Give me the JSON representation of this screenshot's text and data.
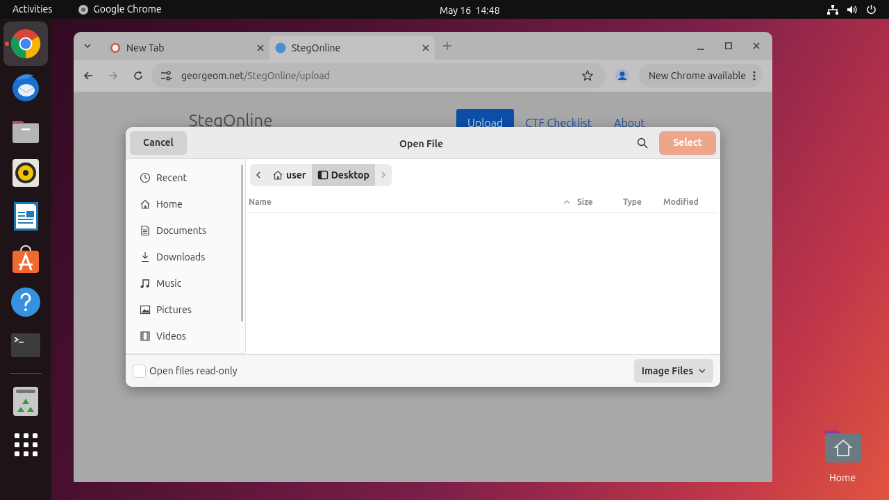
{
  "top_bar": {
    "activities": "Activities",
    "app_name": "Google Chrome",
    "clock": "May 16  14:48"
  },
  "dock": [
    {
      "kind": "chrome",
      "running": true
    },
    {
      "kind": "mail",
      "running": false
    },
    {
      "kind": "files",
      "running": false
    },
    {
      "kind": "speaker",
      "running": false
    },
    {
      "kind": "writer",
      "running": false
    },
    {
      "kind": "store",
      "running": false
    },
    {
      "kind": "help",
      "running": false
    },
    {
      "kind": "terminal",
      "running": false
    },
    {
      "kind": "trash",
      "running": false
    },
    {
      "kind": "apps",
      "running": false
    }
  ],
  "browser": {
    "tabs": [
      {
        "title": "New Tab",
        "selected": false
      },
      {
        "title": "StegOnline",
        "selected": true
      }
    ],
    "address": {
      "host": "georgeom.net",
      "path": "/StegOnline/upload"
    },
    "update_button": "New Chrome available",
    "page": {
      "site_title": "StegOnline",
      "nav": [
        {
          "label": "Upload",
          "selected": true
        },
        {
          "label": "CTF Checklist",
          "selected": false
        },
        {
          "label": "About",
          "selected": false
        }
      ]
    }
  },
  "dialog": {
    "title": "Open File",
    "cancel": "Cancel",
    "select": {
      "label": "Select",
      "disabled": true
    },
    "sidebar": [
      {
        "label": "Recent",
        "kind": "clock"
      },
      {
        "label": "Home",
        "kind": "home"
      },
      {
        "label": "Documents",
        "kind": "document"
      },
      {
        "label": "Downloads",
        "kind": "download"
      },
      {
        "label": "Music",
        "kind": "music"
      },
      {
        "label": "Pictures",
        "kind": "image"
      },
      {
        "label": "Videos",
        "kind": "film"
      }
    ],
    "path": [
      {
        "label": "user",
        "kind": "home",
        "selected": false
      },
      {
        "label": "Desktop",
        "kind": "desktop",
        "selected": true
      }
    ],
    "columns": [
      {
        "label": "Name",
        "sorted": false
      },
      {
        "label": "Size",
        "sorted": true
      },
      {
        "label": "Type",
        "sorted": false
      },
      {
        "label": "Modified",
        "sorted": false
      }
    ],
    "read_only": {
      "label": "Open files read-only",
      "checked": false
    },
    "filter": "Image Files"
  },
  "desktop_icons": [
    {
      "label": "Home"
    }
  ]
}
